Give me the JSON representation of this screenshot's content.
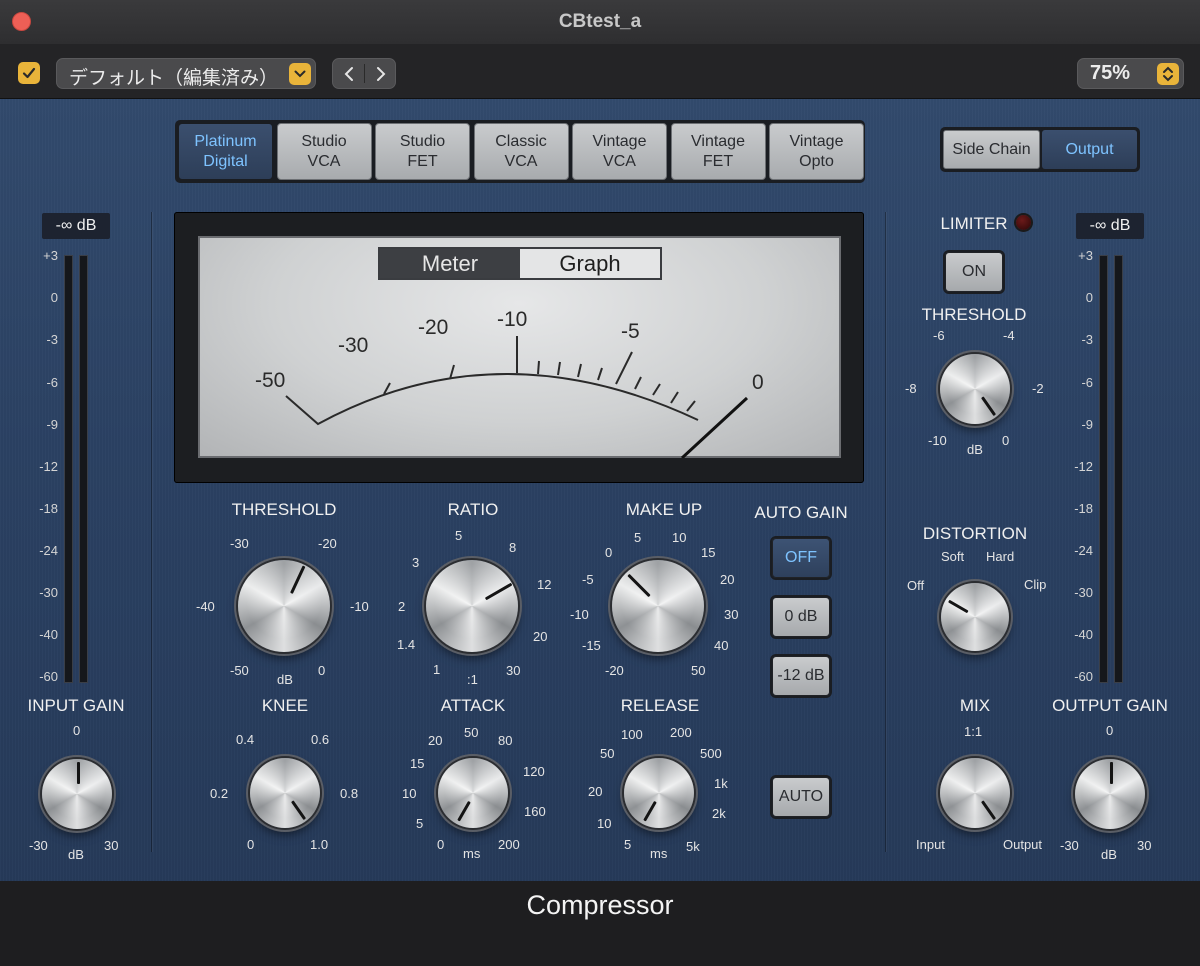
{
  "window": {
    "title": "CBtest_a"
  },
  "toolbar": {
    "preset": "デフォルト（編集済み）",
    "zoom": "75%",
    "icons": {
      "enable": "checkmark-icon",
      "preset_arrow": "chevron-updown-icon",
      "prev": "chevron-left-icon",
      "next": "chevron-right-icon"
    }
  },
  "models": [
    {
      "line1": "Platinum",
      "line2": "Digital",
      "active": true
    },
    {
      "line1": "Studio",
      "line2": "VCA",
      "active": false
    },
    {
      "line1": "Studio",
      "line2": "FET",
      "active": false
    },
    {
      "line1": "Classic",
      "line2": "VCA",
      "active": false
    },
    {
      "line1": "Vintage",
      "line2": "VCA",
      "active": false
    },
    {
      "line1": "Vintage",
      "line2": "FET",
      "active": false
    },
    {
      "line1": "Vintage",
      "line2": "Opto",
      "active": false
    }
  ],
  "view_buttons": {
    "side_chain": "Side Chain",
    "output": "Output",
    "output_active": true
  },
  "meter": {
    "tabs": {
      "meter": "Meter",
      "graph": "Graph",
      "active": "meter"
    },
    "scale": [
      "-50",
      "-30",
      "-20",
      "-10",
      "-5",
      "0"
    ]
  },
  "input": {
    "readout": "-∞ dB",
    "scale": [
      "+3",
      "0",
      "-3",
      "-6",
      "-9",
      "-12",
      "-18",
      "-24",
      "-30",
      "-40",
      "-60"
    ],
    "label": "INPUT GAIN",
    "ticks": {
      "top": "0",
      "left": "-30",
      "right": "30",
      "unit": "dB"
    }
  },
  "output": {
    "readout": "-∞ dB",
    "scale": [
      "+3",
      "0",
      "-3",
      "-6",
      "-9",
      "-12",
      "-18",
      "-24",
      "-30",
      "-40",
      "-60"
    ],
    "label": "OUTPUT GAIN",
    "ticks": {
      "top": "0",
      "left": "-30",
      "right": "30",
      "unit": "dB"
    }
  },
  "threshold": {
    "label": "THRESHOLD",
    "ticks": [
      "-30",
      "-20",
      "-40",
      "-10",
      "-50",
      "0"
    ],
    "unit": "dB"
  },
  "ratio": {
    "label": "RATIO",
    "ticks": [
      "5",
      "8",
      "3",
      "12",
      "2",
      "20",
      "1.4",
      "1",
      "30"
    ],
    "unit": ":1"
  },
  "makeup": {
    "label": "MAKE UP",
    "ticks": [
      "5",
      "10",
      "0",
      "15",
      "-5",
      "20",
      "-10",
      "30",
      "-15",
      "40",
      "-20",
      "50"
    ]
  },
  "autogain": {
    "label": "AUTO GAIN",
    "off": "OFF",
    "zero": "0 dB",
    "minus12": "-12 dB",
    "auto": "AUTO"
  },
  "knee": {
    "label": "KNEE",
    "ticks": [
      "0.4",
      "0.6",
      "0.2",
      "0.8",
      "0",
      "1.0"
    ]
  },
  "attack": {
    "label": "ATTACK",
    "ticks": [
      "50",
      "20",
      "80",
      "15",
      "120",
      "10",
      "160",
      "5",
      "200",
      "0"
    ],
    "unit": "ms"
  },
  "release": {
    "label": "RELEASE",
    "ticks": [
      "100",
      "200",
      "50",
      "500",
      "1k",
      "20",
      "2k",
      "10",
      "5k",
      "5"
    ],
    "unit": "ms"
  },
  "limiter": {
    "label": "LIMITER",
    "on": "ON",
    "threshold_label": "THRESHOLD",
    "ticks": [
      "-6",
      "-4",
      "-8",
      "-2",
      "-10",
      "0"
    ],
    "unit": "dB"
  },
  "distortion": {
    "label": "DISTORTION",
    "ticks": [
      "Soft",
      "Hard",
      "Off",
      "Clip"
    ]
  },
  "mix": {
    "label": "MIX",
    "ticks": [
      "1:1",
      "Input",
      "Output"
    ]
  },
  "footer": {
    "title": "Compressor"
  }
}
